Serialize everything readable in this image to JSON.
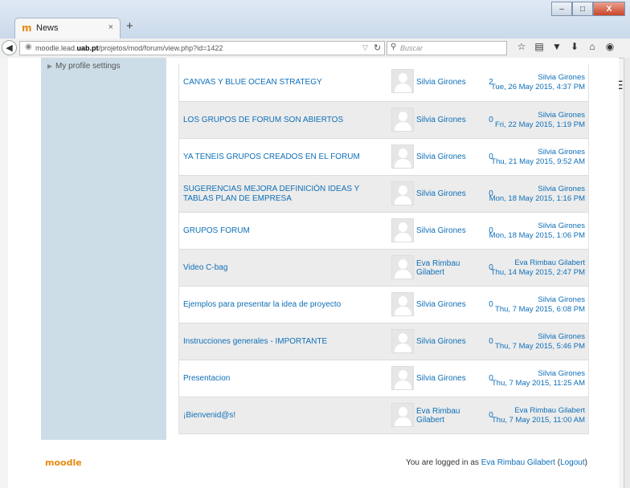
{
  "browser": {
    "tab_title": "News",
    "tab_close": "×",
    "new_tab": "+",
    "url_prefix": "moodle.lead.",
    "url_domain": "uab.pt",
    "url_path": "/projetos/mod/forum/view.php?id=1422",
    "search_placeholder": "Buscar",
    "window_buttons": [
      "–",
      "□",
      "X"
    ]
  },
  "sidebar": {
    "items": [
      {
        "label": "My profile settings"
      }
    ]
  },
  "discussions": [
    {
      "subject": "CANVAS Y BLUE OCEAN STRATEGY",
      "author": "Silvia Girones",
      "replies": "2",
      "last_author": "Silvia Girones",
      "last_date": "Tue, 26 May 2015, 4:37 PM"
    },
    {
      "subject": "LOS GRUPOS DE FORUM SON ABIERTOS",
      "author": "Silvia Girones",
      "replies": "0",
      "last_author": "Silvia Girones",
      "last_date": "Fri, 22 May 2015, 1:19 PM"
    },
    {
      "subject": "YA TENEIS GRUPOS CREADOS EN EL FORUM",
      "author": "Silvia Girones",
      "replies": "0",
      "last_author": "Silvia Girones",
      "last_date": "Thu, 21 May 2015, 9:52 AM"
    },
    {
      "subject": "SUGERENCIAS MEJORA DEFINICIÓN IDEAS Y TABLAS PLAN DE EMPRESA",
      "author": "Silvia Girones",
      "replies": "0",
      "last_author": "Silvia Girones",
      "last_date": "Mon, 18 May 2015, 1:16 PM"
    },
    {
      "subject": "GRUPOS FORUM",
      "author": "Silvia Girones",
      "replies": "0",
      "last_author": "Silvia Girones",
      "last_date": "Mon, 18 May 2015, 1:06 PM"
    },
    {
      "subject": "Video C-bag",
      "author": "Eva Rimbau Gilabert",
      "replies": "0",
      "last_author": "Eva Rimbau Gilabert",
      "last_date": "Thu, 14 May 2015, 2:47 PM"
    },
    {
      "subject": "Ejemplos para presentar la idea de proyecto",
      "author": "Silvia Girones",
      "replies": "0",
      "last_author": "Silvia Girones",
      "last_date": "Thu, 7 May 2015, 6:08 PM"
    },
    {
      "subject": "Instrucciones generales - IMPORTANTE",
      "author": "Silvia Girones",
      "replies": "0",
      "last_author": "Silvia Girones",
      "last_date": "Thu, 7 May 2015, 5:46 PM"
    },
    {
      "subject": "Presentacion",
      "author": "Silvia Girones",
      "replies": "0",
      "last_author": "Silvia Girones",
      "last_date": "Thu, 7 May 2015, 11:25 AM"
    },
    {
      "subject": "¡Bienvenid@s!",
      "author": "Eva Rimbau Gilabert",
      "replies": "0",
      "last_author": "Eva Rimbau Gilabert",
      "last_date": "Thu, 7 May 2015, 11:00 AM"
    }
  ],
  "footer": {
    "logo": "moodle",
    "logged_in_prefix": "You are logged in as ",
    "user_name": "Eva Rimbau Gilabert",
    "logout_open": " (",
    "logout": "Logout",
    "logout_close": ")"
  },
  "colors": {
    "link": "#0f6fb7",
    "sidebar_bg": "#ccdde7",
    "row_alt": "#ececec",
    "moodle_orange": "#e98a10"
  }
}
